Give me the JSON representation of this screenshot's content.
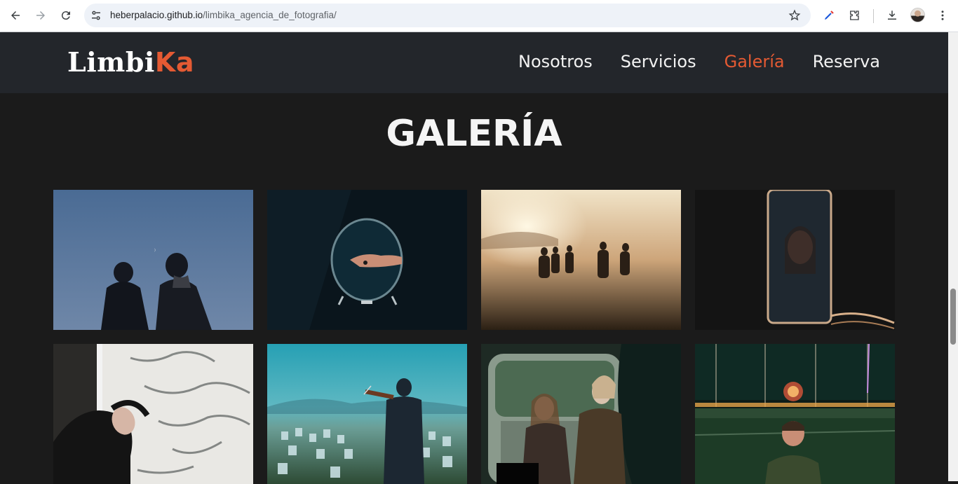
{
  "browser": {
    "url_host": "heberpalacio.github.io",
    "url_path": "/limbika_agencia_de_fotografia/"
  },
  "site": {
    "logo_part1": "Limbi",
    "logo_part2": "Ka",
    "accent_color": "#e45a33",
    "nav": [
      {
        "label": "Nosotros"
      },
      {
        "label": "Servicios"
      },
      {
        "label": "Galería"
      },
      {
        "label": "Reserva"
      }
    ],
    "active_nav": "Galería"
  },
  "gallery": {
    "title": "GALERÍA",
    "photos": [
      {
        "icon": "photo-two-women-night-sky-moon"
      },
      {
        "icon": "photo-hand-in-mirror"
      },
      {
        "icon": "photo-people-in-foggy-sunset"
      },
      {
        "icon": "photo-woman-train-window"
      },
      {
        "icon": "photo-woman-lying-on-foam"
      },
      {
        "icon": "photo-violinist-field-of-chairs"
      },
      {
        "icon": "photo-two-women-by-car"
      },
      {
        "icon": "photo-woman-fireworks-night"
      }
    ]
  }
}
